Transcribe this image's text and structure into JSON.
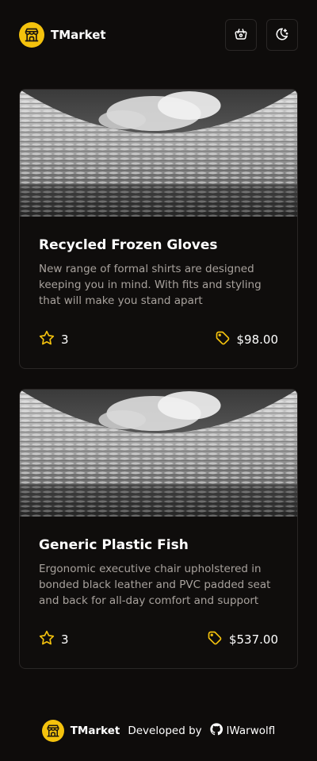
{
  "app": {
    "name": "TMarket"
  },
  "header": {
    "cart_icon": "basket-icon",
    "theme_icon": "moon-stars-icon"
  },
  "colors": {
    "accent": "#f4c20d",
    "background": "#0e0c0b",
    "card_border": "#2a2726",
    "muted_text": "#a8a29d"
  },
  "products": [
    {
      "title": "Recycled Frozen Gloves",
      "description": "New range of formal shirts are designed keeping you in mind. With fits and styling that will make you stand apart",
      "rating": "3",
      "price": "$98.00"
    },
    {
      "title": "Generic Plastic Fish",
      "description": "Ergonomic executive chair upholstered in bonded black leather and PVC padded seat and back for all-day comfort and support",
      "rating": "3",
      "price": "$537.00"
    }
  ],
  "footer": {
    "brand": "TMarket",
    "developed_by": "Developed by",
    "author": "lWarwolfl"
  }
}
